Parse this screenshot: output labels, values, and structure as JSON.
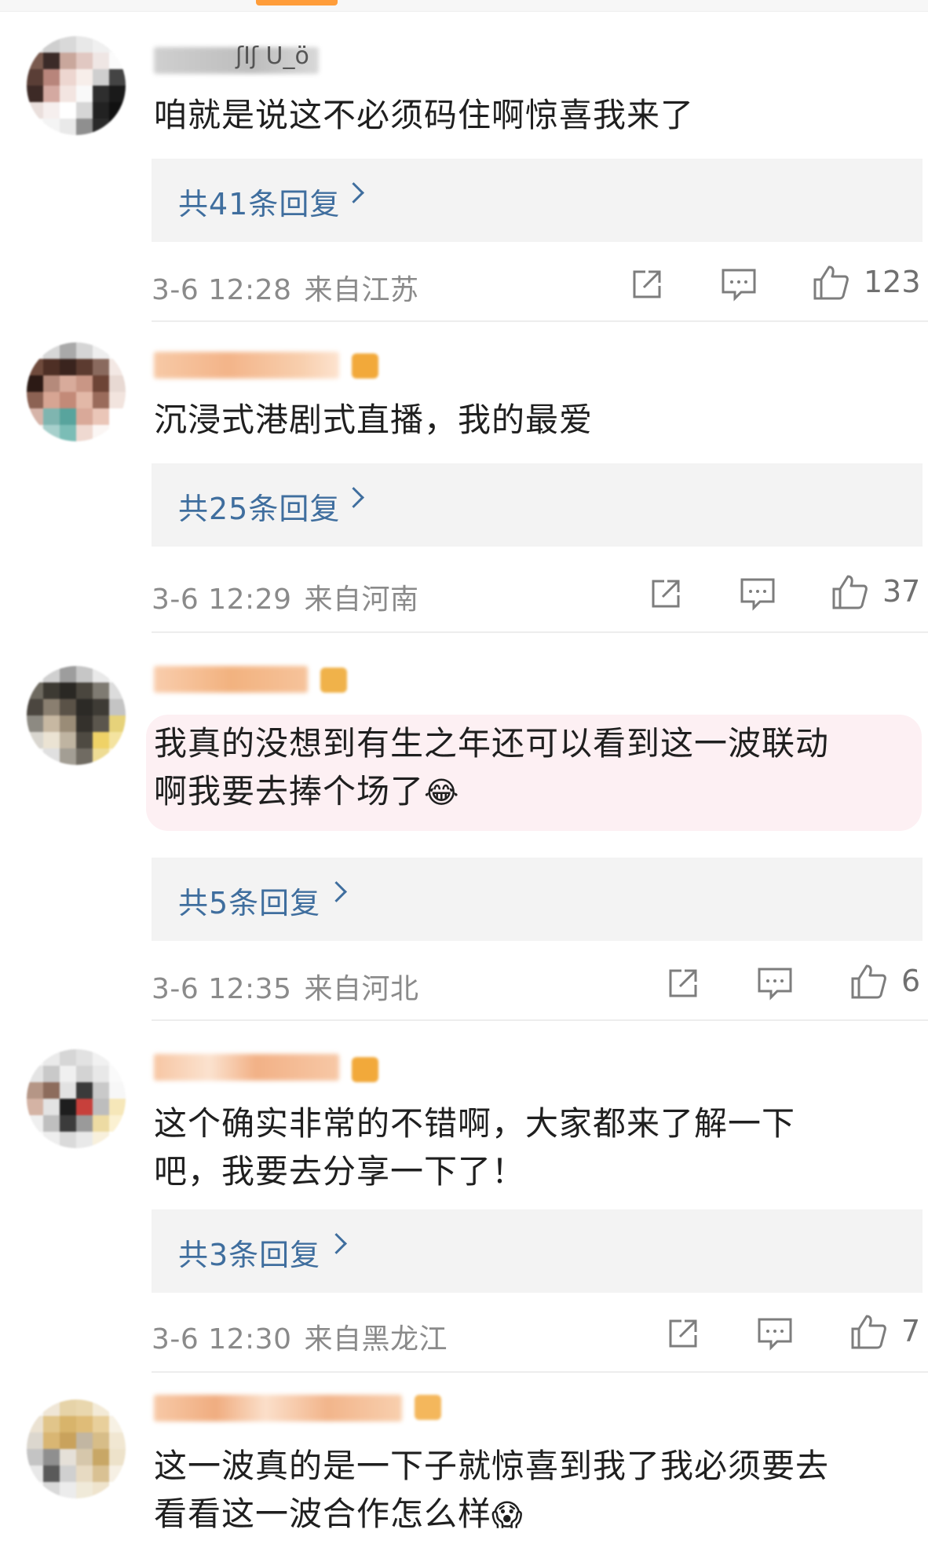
{
  "comments": [
    {
      "username_visible": "ʃIʃ U_ö",
      "text": "咱就是说这不必须码住啊惊喜我来了",
      "reply_label": "共41条回复",
      "timestamp": "3-6 12:28",
      "location": "来自江苏",
      "likes": "123"
    },
    {
      "text": "沉浸式港剧式直播，我的最爱",
      "reply_label": "共25条回复",
      "timestamp": "3-6 12:29",
      "location": "来自河南",
      "likes": "37"
    },
    {
      "text_line1": "我真的没想到有生之年还可以看到这一波联动",
      "text_line2": "啊我要去捧个场了",
      "emoji": "😂",
      "reply_label": "共5条回复",
      "timestamp": "3-6 12:35",
      "location": "来自河北",
      "likes": "6"
    },
    {
      "text_line1": "这个确实非常的不错啊，大家都来了解一下",
      "text_line2": "吧，我要去分享一下了！",
      "reply_label": "共3条回复",
      "timestamp": "3-6 12:30",
      "location": "来自黑龙江",
      "likes": "7"
    },
    {
      "text_line1": "这一波真的是一下子就惊喜到我了我必须要去",
      "text_line2": "看看这一波合作怎么样",
      "emoji": "😱"
    }
  ],
  "icons": {
    "share": "share-icon",
    "comment": "comment-icon",
    "like": "thumbs-up-icon",
    "chevron": "chevron-right-icon"
  },
  "colors": {
    "link_blue": "#3f6e9e",
    "meta_gray": "#8a8a8a",
    "reply_bg": "#f3f3f3",
    "highlight_pink": "#fdf0f3",
    "badge_orange": "#f2a93a"
  }
}
